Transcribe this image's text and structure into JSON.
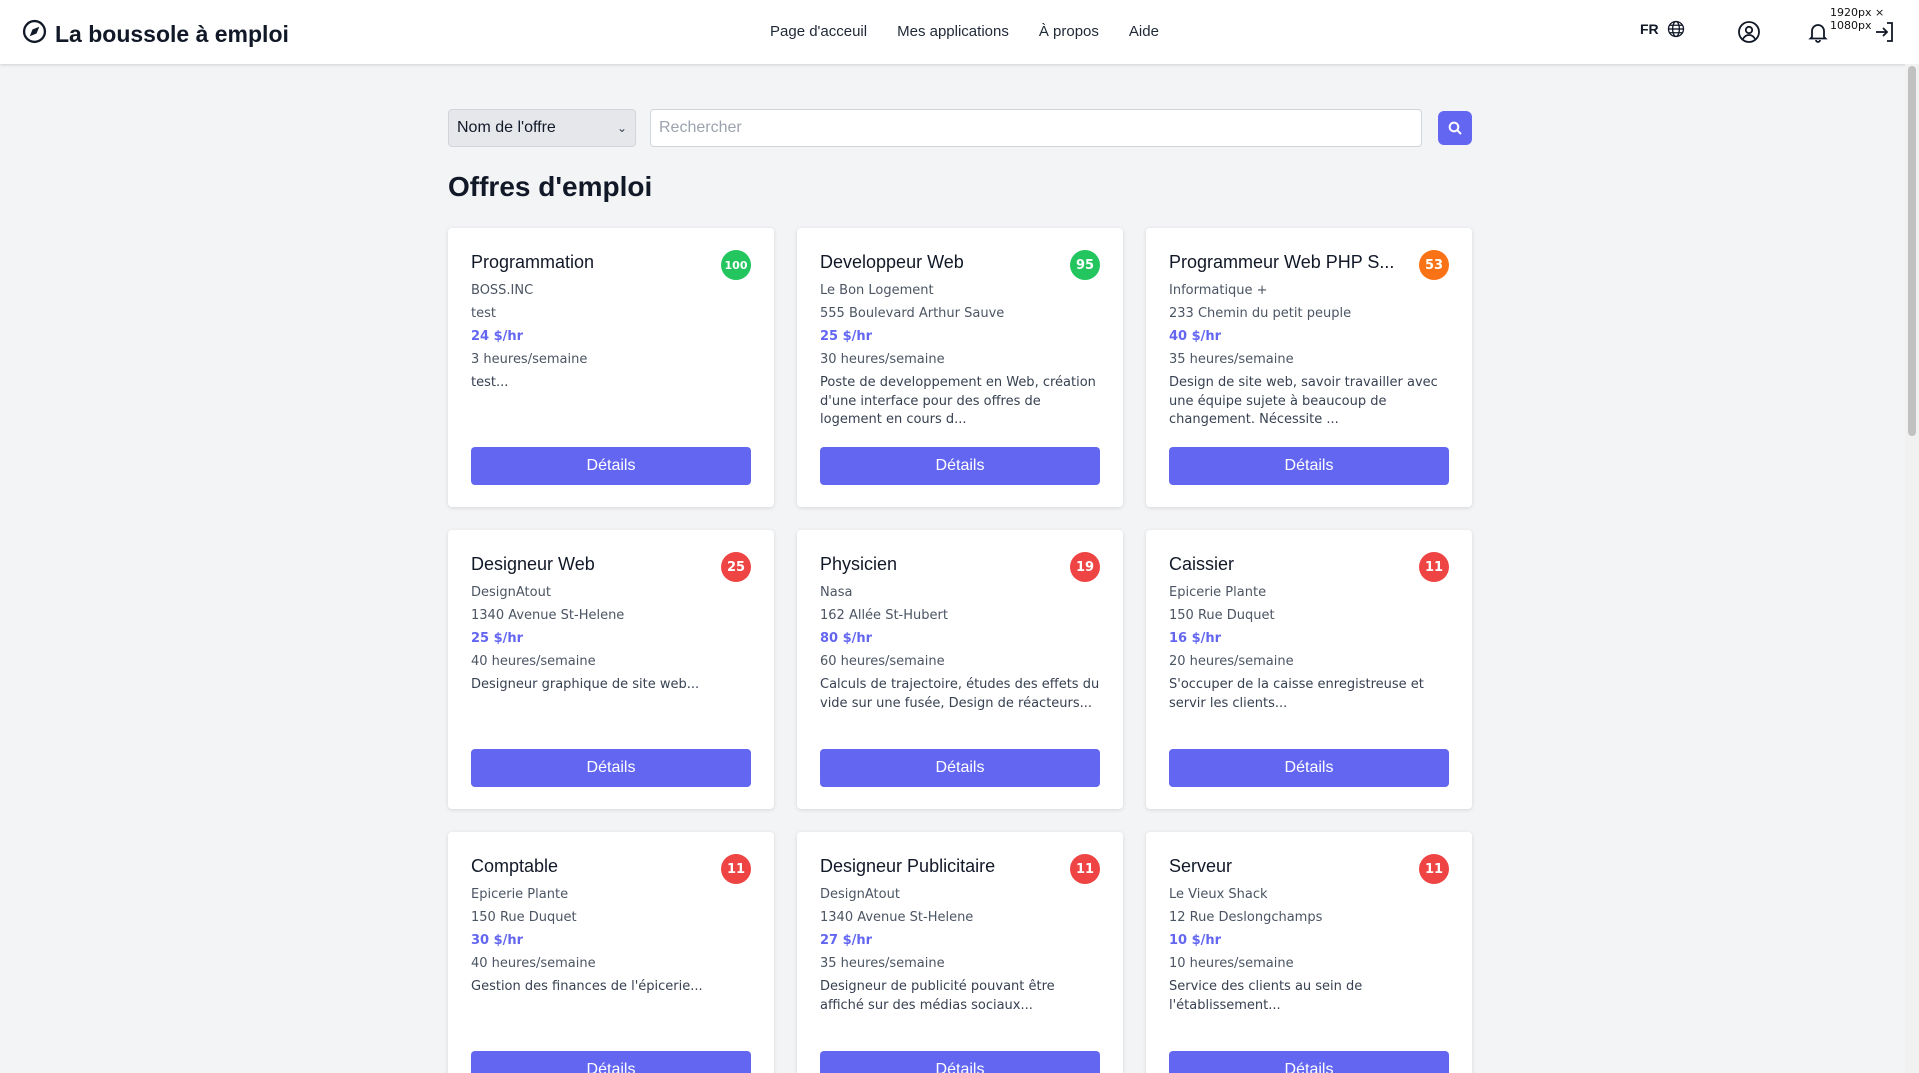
{
  "brand": {
    "title": "La boussole à emploi"
  },
  "nav": [
    {
      "label": "Page d'acceuil"
    },
    {
      "label": "Mes applications"
    },
    {
      "label": "À propos"
    },
    {
      "label": "Aide"
    }
  ],
  "header": {
    "lang": "FR",
    "resolution": "1920px × 1080px"
  },
  "search": {
    "filter_selected": "Nom de l'offre",
    "placeholder": "Rechercher",
    "value": ""
  },
  "page_title": "Offres d'emploi",
  "details_label": "Détails",
  "colors": {
    "accent": "#6366f1",
    "score_high": "#22c55e",
    "score_mid": "#f97316",
    "score_low": "#ef4444"
  },
  "jobs": [
    {
      "title": "Programmation",
      "score": "100",
      "level": "high",
      "company": "BOSS.INC",
      "address": "test",
      "pay": "24 $/hr",
      "hours": "3 heures/semaine",
      "description": "test..."
    },
    {
      "title": "Developpeur Web",
      "score": "95",
      "level": "high",
      "company": "Le Bon Logement",
      "address": "555 Boulevard Arthur Sauve",
      "pay": "25 $/hr",
      "hours": "30 heures/semaine",
      "description": "Poste de developpement en Web, création d'une interface pour des offres de logement en cours d..."
    },
    {
      "title": "Programmeur Web PHP S...",
      "score": "53",
      "level": "mid",
      "company": "Informatique +",
      "address": "233 Chemin du petit peuple",
      "pay": "40 $/hr",
      "hours": "35 heures/semaine",
      "description": "Design de site web, savoir travailler avec une équipe sujete à beaucoup de changement. Nécessite ..."
    },
    {
      "title": "Designeur Web",
      "score": "25",
      "level": "low",
      "company": "DesignAtout",
      "address": "1340 Avenue St-Helene",
      "pay": "25 $/hr",
      "hours": "40 heures/semaine",
      "description": "Designeur graphique de site web..."
    },
    {
      "title": "Physicien",
      "score": "19",
      "level": "low",
      "company": "Nasa",
      "address": "162 Allée St-Hubert",
      "pay": "80 $/hr",
      "hours": "60 heures/semaine",
      "description": "Calculs de trajectoire, études des effets du vide sur une fusée, Design de réacteurs..."
    },
    {
      "title": "Caissier",
      "score": "11",
      "level": "low",
      "company": "Epicerie Plante",
      "address": "150 Rue Duquet",
      "pay": "16 $/hr",
      "hours": "20 heures/semaine",
      "description": "S'occuper de la caisse enregistreuse et servir les clients..."
    },
    {
      "title": "Comptable",
      "score": "11",
      "level": "low",
      "company": "Epicerie Plante",
      "address": "150 Rue Duquet",
      "pay": "30 $/hr",
      "hours": "40 heures/semaine",
      "description": "Gestion des finances de l'épicerie..."
    },
    {
      "title": "Designeur Publicitaire",
      "score": "11",
      "level": "low",
      "company": "DesignAtout",
      "address": "1340 Avenue St-Helene",
      "pay": "27 $/hr",
      "hours": "35 heures/semaine",
      "description": "Designeur de publicité pouvant être affiché sur des médias sociaux..."
    },
    {
      "title": "Serveur",
      "score": "11",
      "level": "low",
      "company": "Le Vieux Shack",
      "address": "12 Rue Deslongchamps",
      "pay": "10 $/hr",
      "hours": "10 heures/semaine",
      "description": "Service des clients au sein de l'établissement..."
    }
  ]
}
